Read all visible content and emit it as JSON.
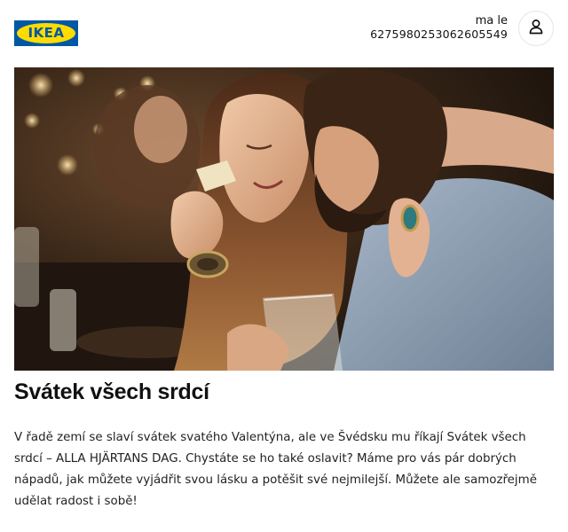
{
  "header": {
    "logo_text": "IKEA",
    "account_name": "ma le",
    "account_number": "6275980253062605549",
    "profile_icon": "person-icon"
  },
  "hero": {
    "image_description_icon": "couple-photo"
  },
  "article": {
    "title": "Svátek všech srdcí",
    "body": "V řadě zemí se slaví svátek svatého Valentýna, ale ve Švédsku mu říkají Svátek všech srdcí – ALLA HJÄRTANS DAG. Chystáte se ho také oslavit? Máme pro vás pár dobrých nápadů, jak můžete vyjádřit svou lásku a potěšit své nejmilejší. Můžete ale samozřejmě udělat radost i sobě!"
  },
  "colors": {
    "brand_blue": "#0058a3",
    "brand_yellow": "#ffdb00"
  }
}
